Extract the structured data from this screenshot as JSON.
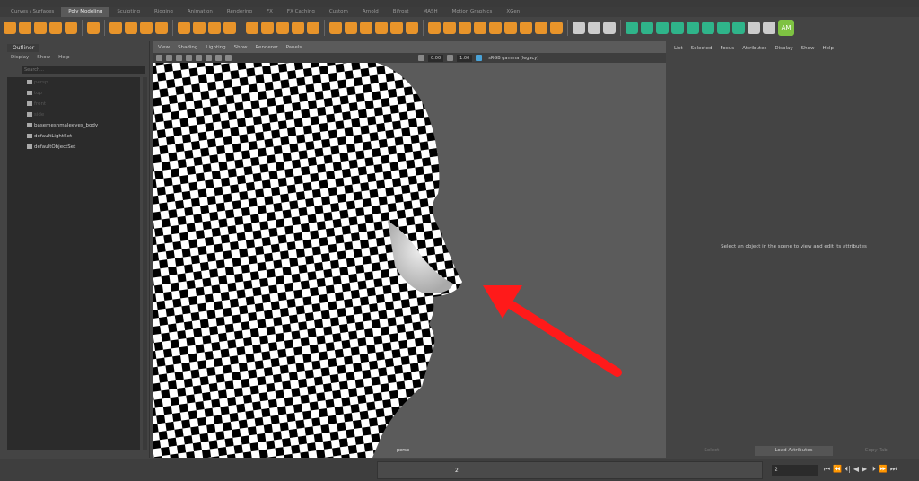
{
  "shelf_tabs": [
    "Curves / Surfaces",
    "Poly Modeling",
    "Sculpting",
    "Rigging",
    "Animation",
    "Rendering",
    "FX",
    "FX Caching",
    "Custom",
    "Arnold",
    "Bifrost",
    "MASH",
    "Motion Graphics",
    "XGen"
  ],
  "active_tab": "Poly Modeling",
  "shelf_badge": "AM",
  "outliner": {
    "tab": "Outliner",
    "menu": [
      "Display",
      "Show",
      "Help"
    ],
    "search_placeholder": "Search...",
    "items": [
      {
        "label": "persp",
        "dim": true
      },
      {
        "label": "top",
        "dim": true
      },
      {
        "label": "front",
        "dim": true
      },
      {
        "label": "side",
        "dim": true
      },
      {
        "label": "basemeshmaleeyes_body",
        "dim": false
      },
      {
        "label": "defaultLightSet",
        "dim": false
      },
      {
        "label": "defaultObjectSet",
        "dim": false
      }
    ]
  },
  "viewport": {
    "menu": [
      "View",
      "Shading",
      "Lighting",
      "Show",
      "Renderer",
      "Panels"
    ],
    "exposure": "0.00",
    "gamma": "1.00",
    "colorspace": "sRGB gamma (legacy)",
    "camera": "persp"
  },
  "attribute_editor": {
    "menu": [
      "List",
      "Selected",
      "Focus",
      "Attributes",
      "Display",
      "Show",
      "Help"
    ],
    "message": "Select an object in the scene to view and edit its attributes",
    "buttons": [
      "Select",
      "Load Attributes",
      "Copy Tab"
    ]
  },
  "timeline": {
    "current_frame": "2",
    "frame_field": "2",
    "playback": [
      "⏮",
      "⏪",
      "⏴|",
      "◀",
      "▶",
      "|⏵",
      "⏩",
      "⏭"
    ]
  },
  "colors": {
    "accent": "#e8942a",
    "arrow": "#ff1a1a",
    "badge": "#7ec242"
  }
}
